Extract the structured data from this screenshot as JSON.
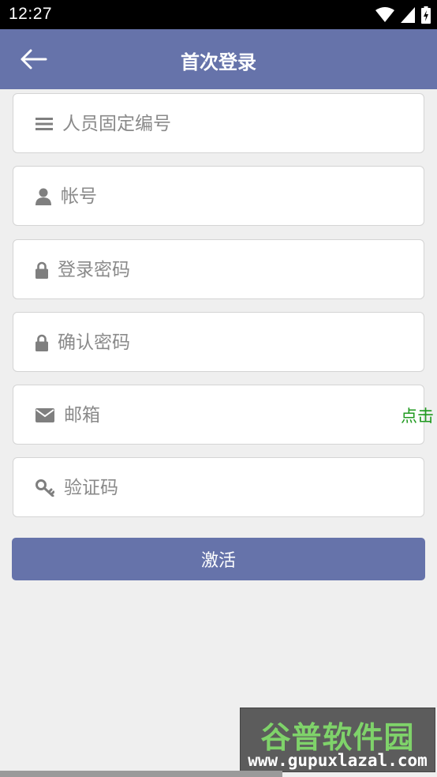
{
  "status_bar": {
    "time": "12:27"
  },
  "app_bar": {
    "title": "首次登录",
    "back_icon": "arrow-left-icon"
  },
  "form": {
    "employee_id": {
      "placeholder": "人员固定编号",
      "icon": "list-icon"
    },
    "account": {
      "placeholder": "帐号",
      "icon": "user-icon"
    },
    "password": {
      "placeholder": "登录密码",
      "icon": "lock-icon"
    },
    "confirm_password": {
      "placeholder": "确认密码",
      "icon": "lock-icon"
    },
    "email": {
      "placeholder": "邮箱",
      "icon": "envelope-icon",
      "action_label": "点击"
    },
    "verification_code": {
      "placeholder": "验证码",
      "icon": "key-icon"
    },
    "submit_label": "激活"
  },
  "watermark": {
    "title": "谷普软件园",
    "url": "www.gupuxlazal.com"
  },
  "colors": {
    "primary": "#6673aa",
    "link": "#1f9a1f",
    "icon": "#7f7f7f"
  }
}
